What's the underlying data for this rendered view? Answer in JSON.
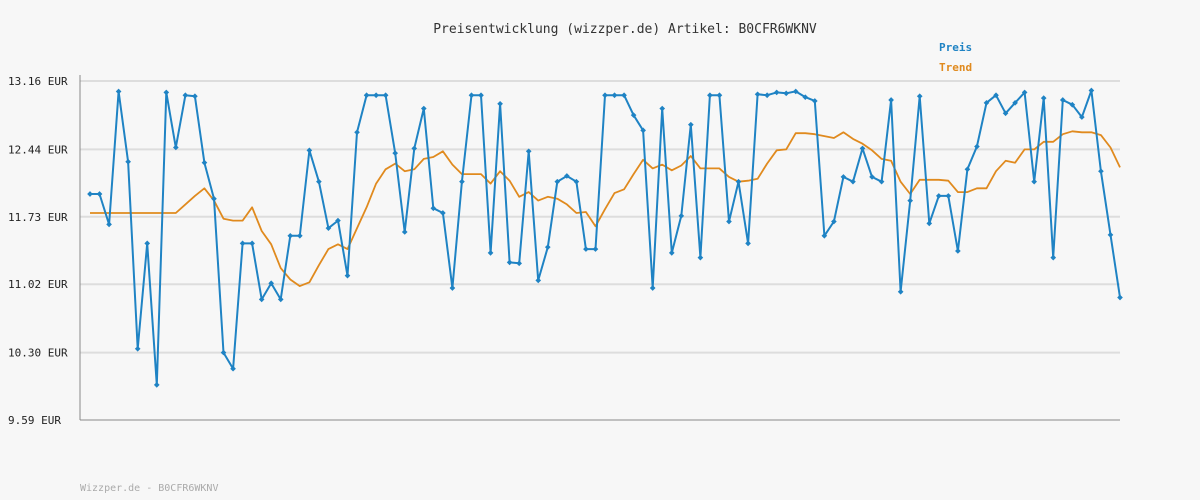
{
  "chart_data": {
    "type": "line",
    "title": "Preisentwicklung (wizzper.de) Artikel: B0CFR6WKNV",
    "footer": "Wizzper.de - B0CFR6WKNV",
    "ylim": [
      9.59,
      13.16
    ],
    "yticks": [
      {
        "value": 13.16,
        "label": "13.16 EUR"
      },
      {
        "value": 12.44,
        "label": "12.44 EUR"
      },
      {
        "value": 11.73,
        "label": "11.73 EUR"
      },
      {
        "value": 11.02,
        "label": "11.02 EUR"
      },
      {
        "value": 10.3,
        "label": "10.30 EUR"
      },
      {
        "value": 9.59,
        "label": "9.59 EUR"
      }
    ],
    "grid": true,
    "legend_position": "top-right",
    "colors": {
      "preis": "#1f83c4",
      "trend": "#e08a1e",
      "grid": "#dddddd",
      "axis": "#888888"
    },
    "series": [
      {
        "name": "Preis",
        "color": "#1f83c4",
        "markers": true,
        "values": [
          11.97,
          11.97,
          11.65,
          13.05,
          12.31,
          10.34,
          11.45,
          9.96,
          13.04,
          12.46,
          13.01,
          13.0,
          12.3,
          11.92,
          10.3,
          10.13,
          11.45,
          11.45,
          10.86,
          11.03,
          10.86,
          11.53,
          11.53,
          12.43,
          12.1,
          11.61,
          11.69,
          11.11,
          12.62,
          13.01,
          13.01,
          13.01,
          12.4,
          11.57,
          12.45,
          12.87,
          11.82,
          11.77,
          10.98,
          12.1,
          13.01,
          13.01,
          11.35,
          12.92,
          11.25,
          11.24,
          12.42,
          11.06,
          11.41,
          12.1,
          12.16,
          12.1,
          11.39,
          11.39,
          13.01,
          13.01,
          13.01,
          12.8,
          12.64,
          10.98,
          12.87,
          11.35,
          11.74,
          12.7,
          11.3,
          13.01,
          13.01,
          11.68,
          12.1,
          11.45,
          13.02,
          13.01,
          13.04,
          13.03,
          13.05,
          12.99,
          12.95,
          11.53,
          11.68,
          12.15,
          12.1,
          12.45,
          12.15,
          12.1,
          12.96,
          10.94,
          11.9,
          13.0,
          11.66,
          11.95,
          11.95,
          11.37,
          12.23,
          12.47,
          12.93,
          13.01,
          12.82,
          12.93,
          13.04,
          12.1,
          12.98,
          11.3,
          12.96,
          12.91,
          12.78,
          13.06,
          12.21,
          11.54,
          10.88
        ]
      },
      {
        "name": "Trend",
        "color": "#e08a1e",
        "markers": false,
        "values": [
          11.77,
          11.77,
          11.77,
          11.77,
          11.77,
          11.77,
          11.77,
          11.77,
          11.77,
          11.77,
          11.86,
          11.95,
          12.03,
          11.9,
          11.71,
          11.69,
          11.69,
          11.83,
          11.58,
          11.44,
          11.19,
          11.07,
          11.0,
          11.04,
          11.22,
          11.39,
          11.44,
          11.39,
          11.61,
          11.83,
          12.08,
          12.23,
          12.29,
          12.21,
          12.23,
          12.34,
          12.36,
          12.42,
          12.28,
          12.18,
          12.18,
          12.18,
          12.08,
          12.21,
          12.11,
          11.94,
          11.99,
          11.9,
          11.94,
          11.92,
          11.86,
          11.77,
          11.78,
          11.63,
          11.81,
          11.98,
          12.02,
          12.18,
          12.33,
          12.24,
          12.28,
          12.22,
          12.27,
          12.37,
          12.24,
          12.24,
          12.24,
          12.15,
          12.1,
          12.11,
          12.13,
          12.29,
          12.43,
          12.44,
          12.61,
          12.61,
          12.6,
          12.58,
          12.56,
          12.62,
          12.55,
          12.5,
          12.43,
          12.34,
          12.32,
          12.1,
          11.97,
          12.12,
          12.12,
          12.12,
          12.11,
          11.99,
          11.99,
          12.03,
          12.03,
          12.21,
          12.32,
          12.3,
          12.44,
          12.44,
          12.52,
          12.52,
          12.6,
          12.63,
          12.62,
          12.62,
          12.59,
          12.46,
          12.25
        ]
      }
    ]
  }
}
